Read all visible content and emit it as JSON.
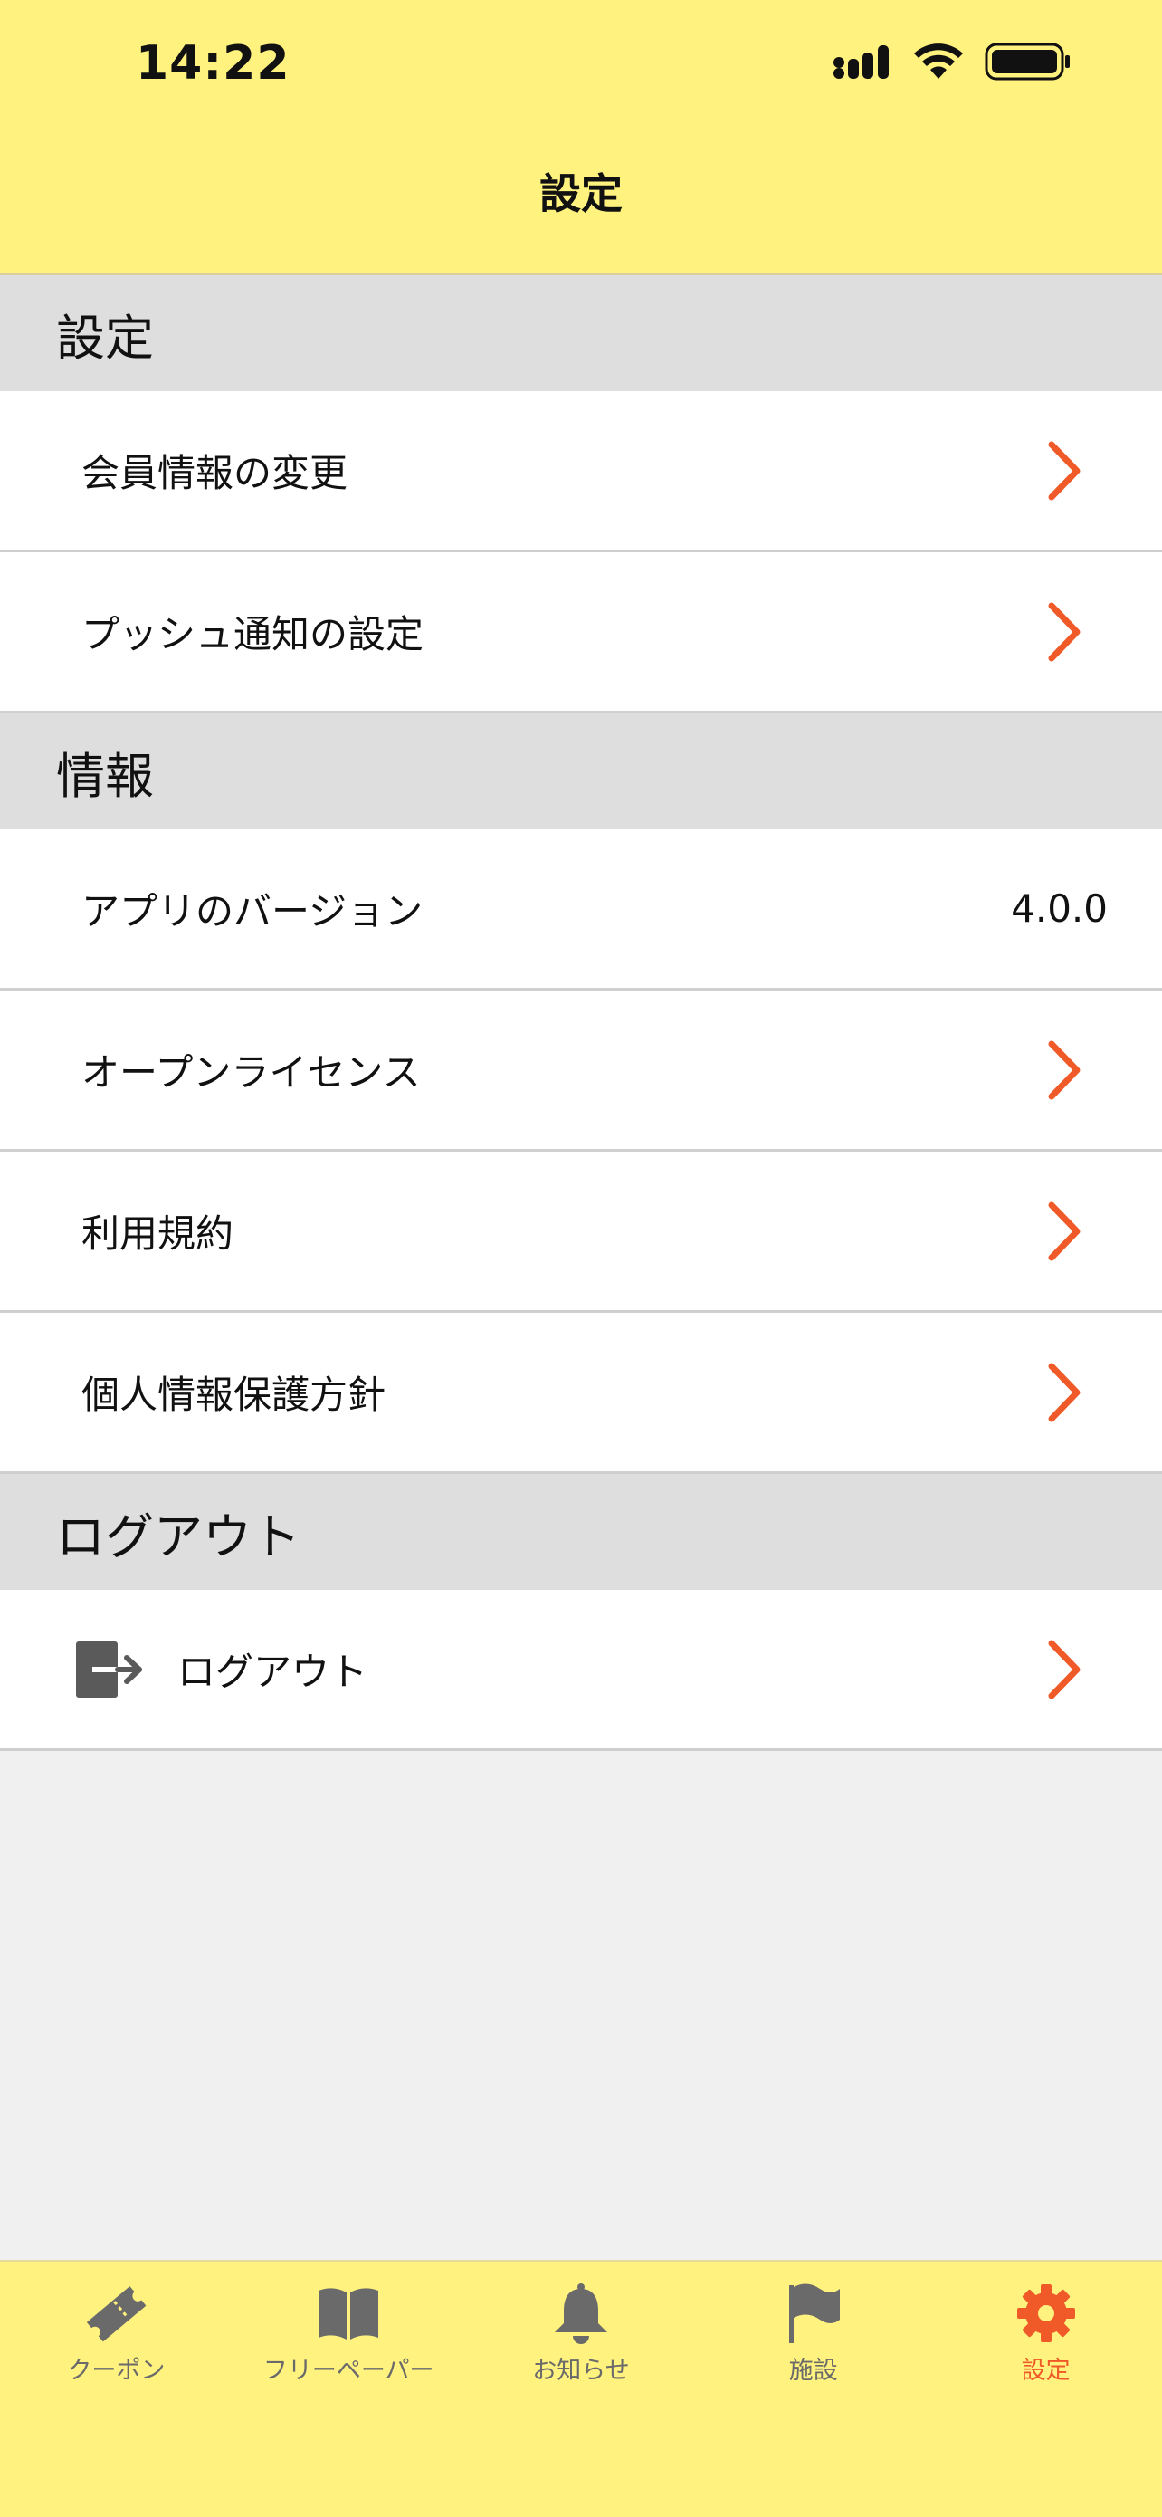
{
  "status_bar": {
    "time": "14:22"
  },
  "nav": {
    "title": "設定"
  },
  "sections": [
    {
      "title": "設定",
      "rows": [
        {
          "label": "会員情報の変更"
        },
        {
          "label": "プッシュ通知の設定"
        }
      ]
    },
    {
      "title": "情報",
      "rows": [
        {
          "label": "アプリのバージョン",
          "value": "4.0.0"
        },
        {
          "label": "オープンライセンス"
        },
        {
          "label": "利用規約"
        },
        {
          "label": "個人情報保護方針"
        }
      ]
    },
    {
      "title": "ログアウト",
      "rows": [
        {
          "label": "ログアウト",
          "icon": "logout-icon"
        }
      ]
    }
  ],
  "tabs": [
    {
      "label": "クーポン",
      "icon": "ticket-icon"
    },
    {
      "label": "フリーペーパー",
      "icon": "book-icon"
    },
    {
      "label": "お知らせ",
      "icon": "bell-icon"
    },
    {
      "label": "施設",
      "icon": "flag-icon"
    },
    {
      "label": "設定",
      "icon": "gear-icon",
      "active": true
    }
  ],
  "colors": {
    "header_bg": "#fff27f",
    "accent": "#f05a28",
    "section_bg": "#dedede",
    "inactive_tab": "#6a6a6a"
  }
}
